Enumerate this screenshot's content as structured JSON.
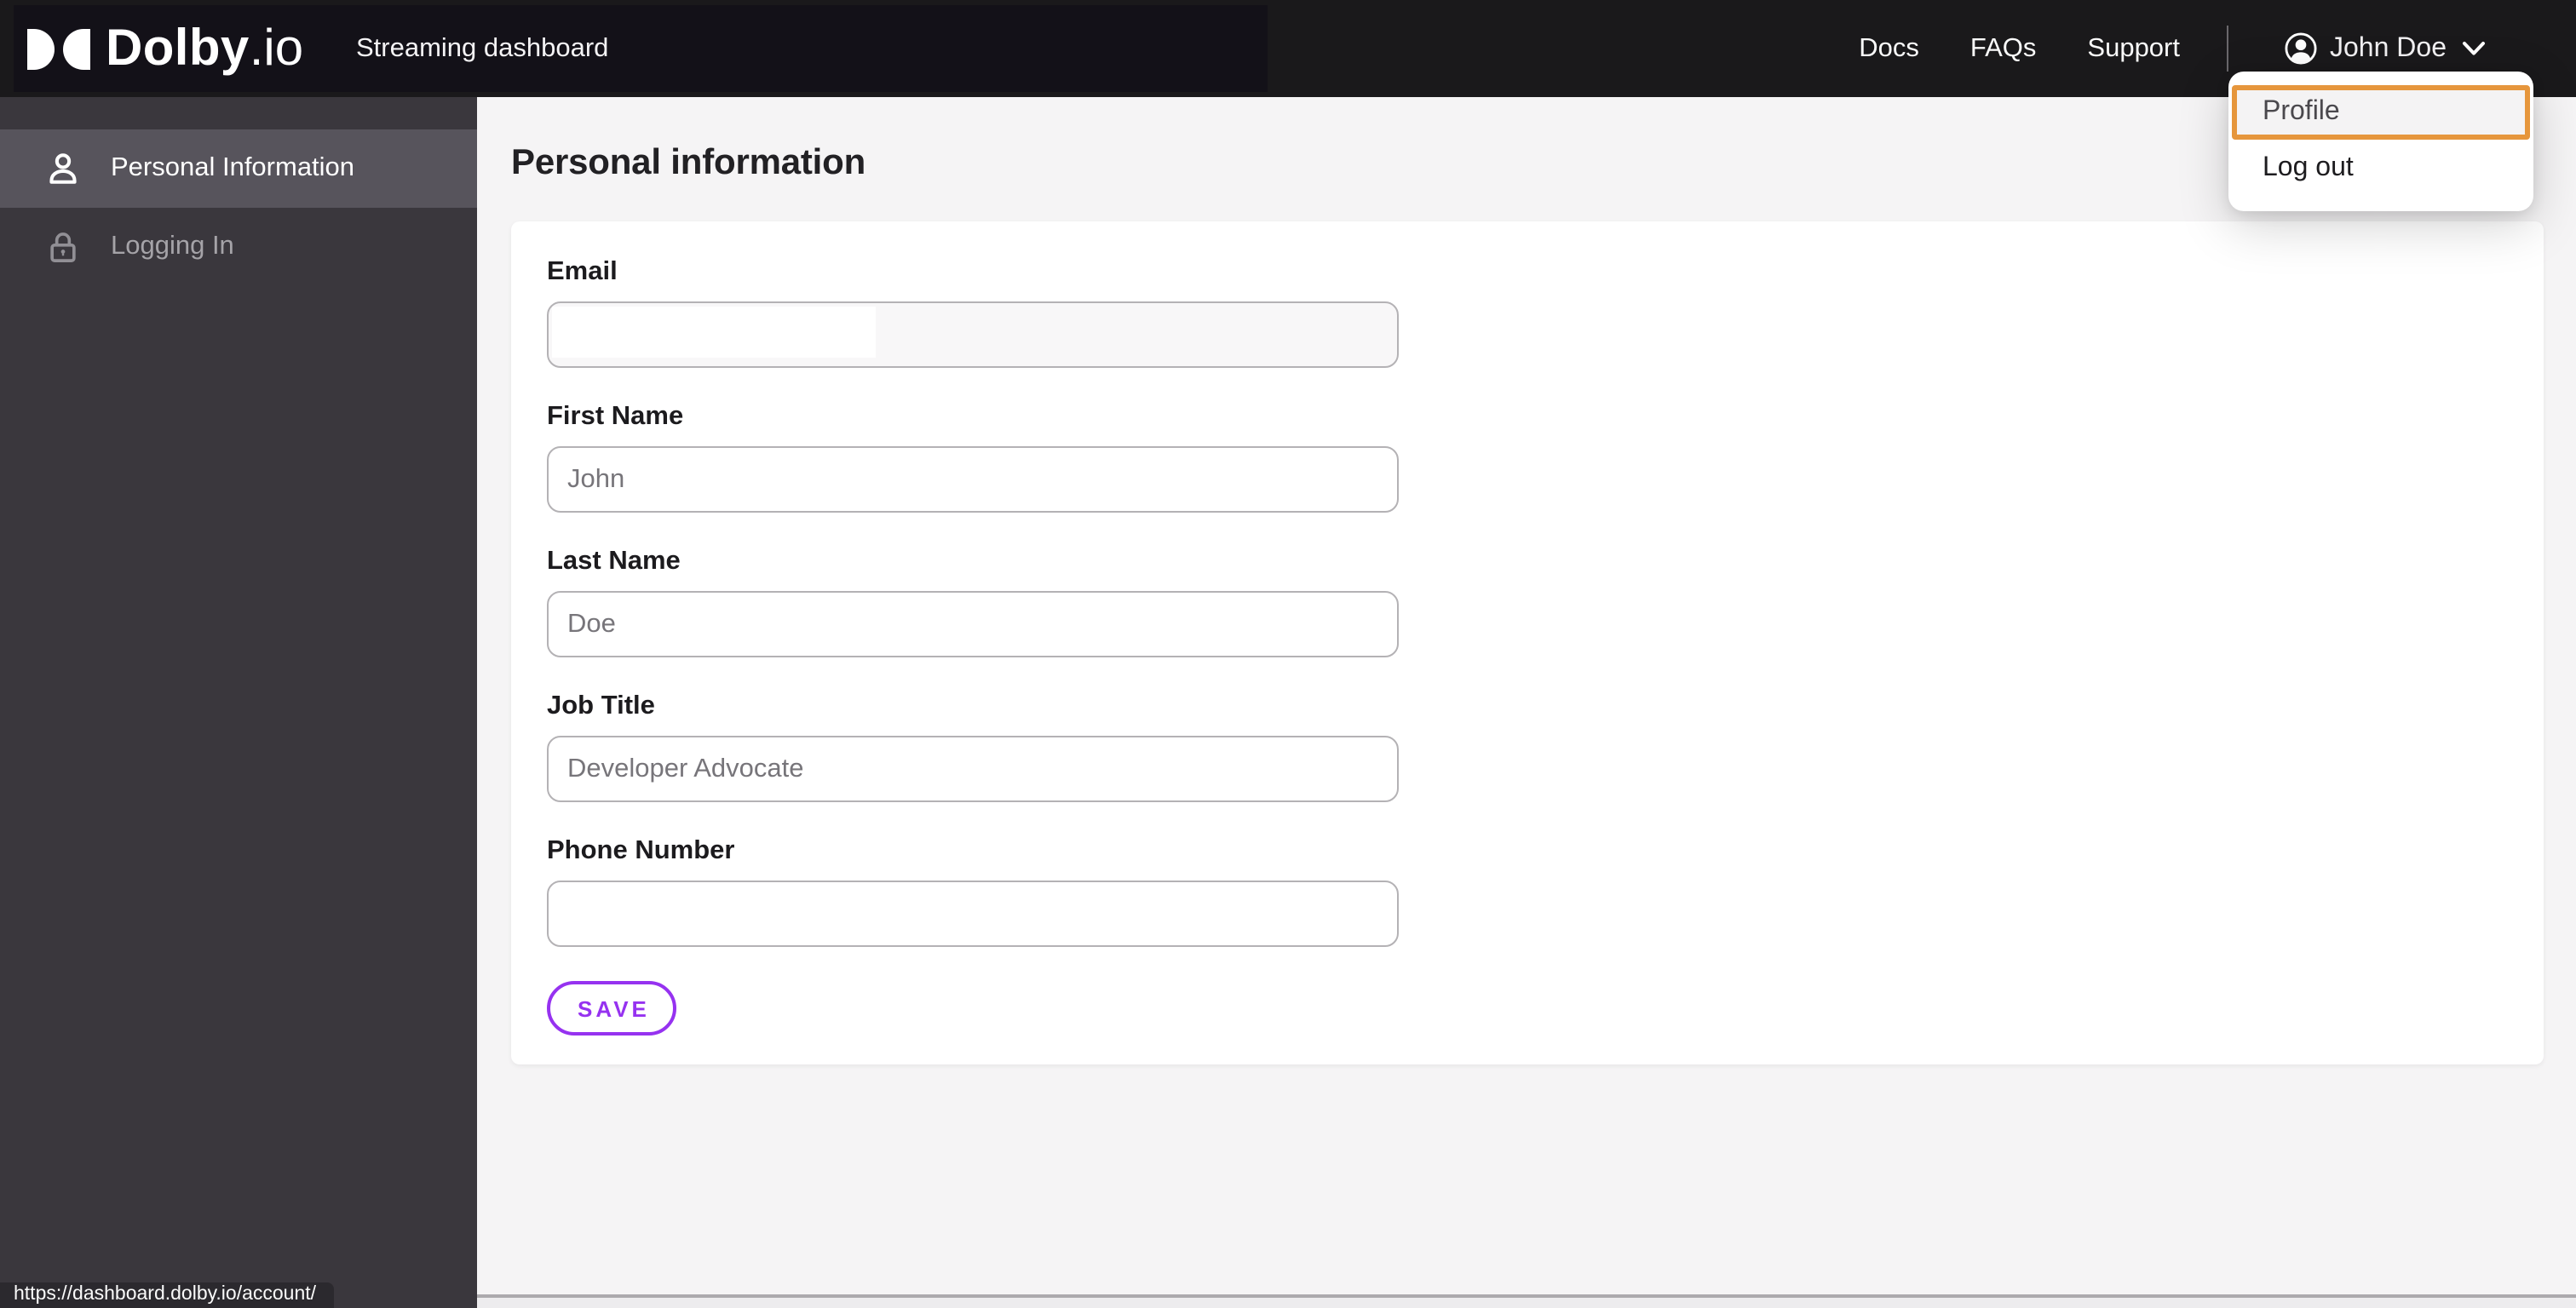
{
  "header": {
    "brand": {
      "name": "Dolby",
      "suffix": ".io",
      "mark": "dolby-double-d-icon"
    },
    "app_title": "Streaming dashboard",
    "nav_links": [
      {
        "label": "Docs"
      },
      {
        "label": "FAQs"
      },
      {
        "label": "Support"
      }
    ],
    "user": {
      "name": "John Doe",
      "avatar_icon": "user-circle-icon",
      "chevron_icon": "chevron-down-icon"
    }
  },
  "user_menu": {
    "items": [
      {
        "label": "Profile",
        "focused": true
      },
      {
        "label": "Log out",
        "focused": false
      }
    ]
  },
  "sidebar": {
    "items": [
      {
        "label": "Personal Information",
        "icon": "person-icon",
        "selected": true
      },
      {
        "label": "Logging In",
        "icon": "lock-icon",
        "selected": false
      }
    ]
  },
  "main": {
    "heading": "Personal information",
    "form": {
      "fields": [
        {
          "label": "Email",
          "value": "",
          "redacted": true
        },
        {
          "label": "First Name",
          "value": "John"
        },
        {
          "label": "Last Name",
          "value": "Doe"
        },
        {
          "label": "Job Title",
          "value": "Developer Advocate"
        },
        {
          "label": "Phone Number",
          "value": ""
        }
      ],
      "save_button": "SAVE"
    }
  },
  "status_bar": {
    "link_preview_url": "https://dashboard.dolby.io/account/"
  },
  "colors": {
    "accent_purple": "#9632f0",
    "focus_orange": "#e6963c",
    "header_bg": "#1a191b",
    "sidebar_bg": "#3a373d",
    "sidebar_selected_bg": "#57545c",
    "content_bg": "#f5f4f5"
  }
}
